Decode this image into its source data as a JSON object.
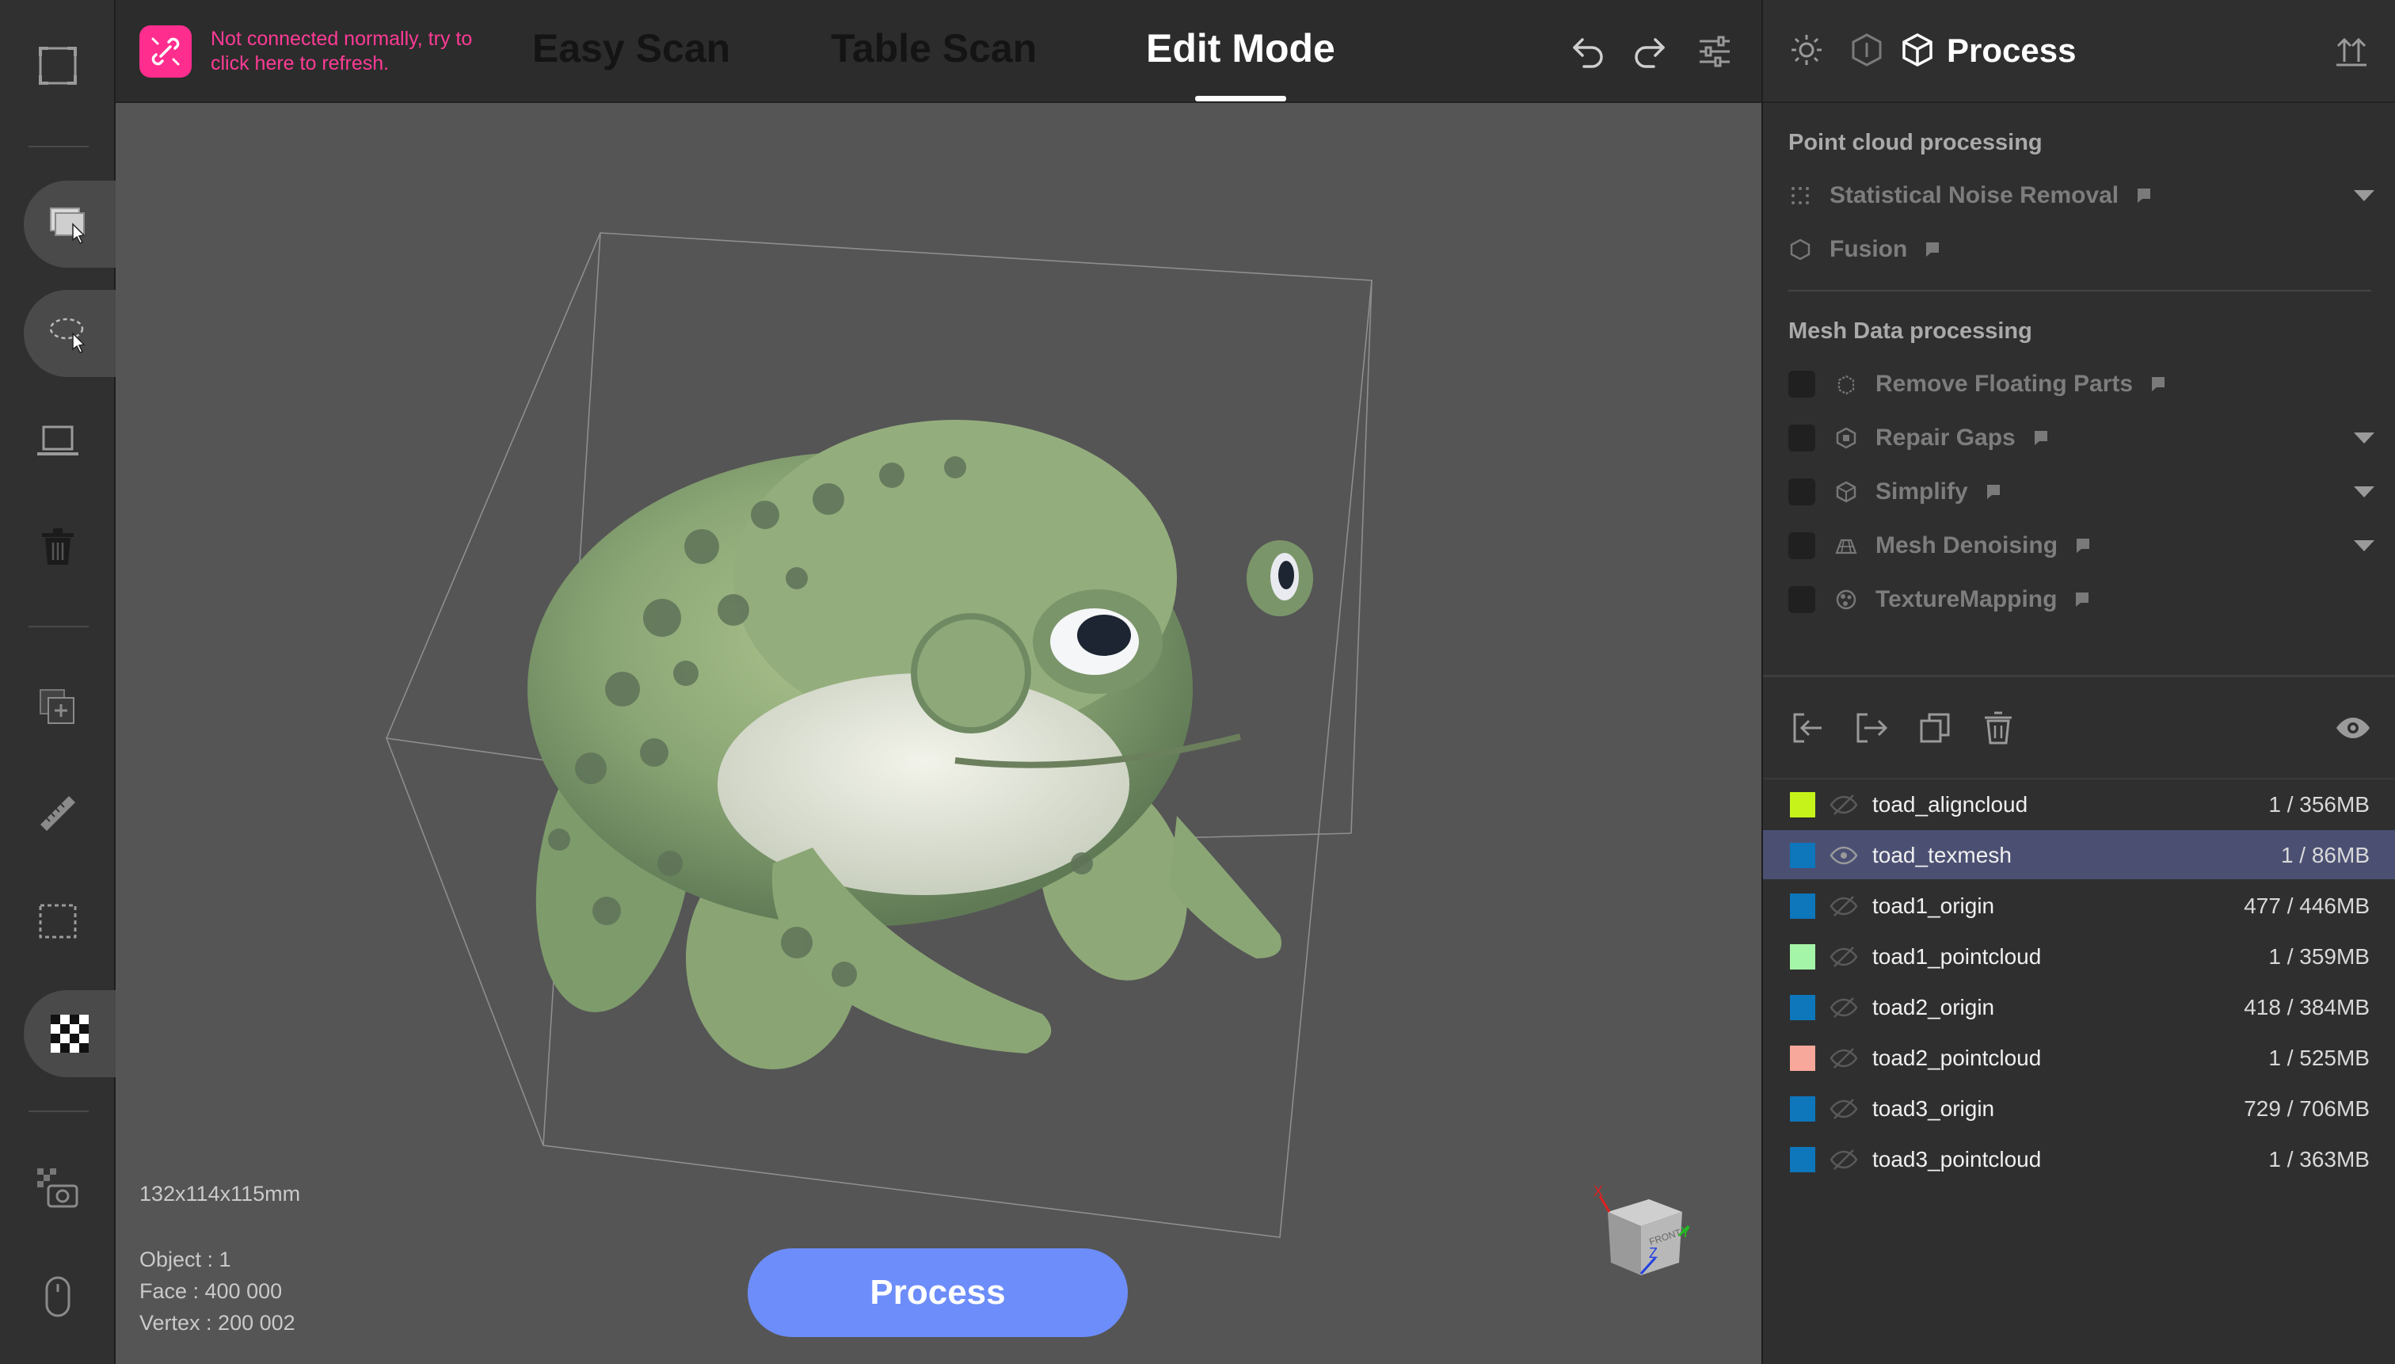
{
  "connection": {
    "message": "Not connected normally, try to click here to refresh.",
    "icon": "broken-link-icon",
    "color": "#ff2d8d"
  },
  "tabs": [
    {
      "label": "Easy Scan",
      "active": false
    },
    {
      "label": "Table Scan",
      "active": false
    },
    {
      "label": "Edit Mode",
      "active": true
    }
  ],
  "viewport": {
    "dimensions": "132x114x115mm",
    "object_line": "Object : 1",
    "face_line": "Face : 400 000",
    "vertex_line": "Vertex : 200 002",
    "process_button": "Process",
    "process_button_color": "#6d8dfa"
  },
  "panel": {
    "title": "Process",
    "point_cloud": {
      "title": "Point cloud processing",
      "items": [
        {
          "label": "Statistical Noise Removal",
          "icon": "dots-icon",
          "has_dropdown": true
        },
        {
          "label": "Fusion",
          "icon": "hexagon-icon",
          "has_dropdown": false
        }
      ]
    },
    "mesh": {
      "title": "Mesh Data processing",
      "items": [
        {
          "label": "Remove Floating Parts",
          "icon": "cube-outline-icon",
          "has_dropdown": false
        },
        {
          "label": "Repair Gaps",
          "icon": "cube-patch-icon",
          "has_dropdown": true
        },
        {
          "label": "Simplify",
          "icon": "mesh-sphere-icon",
          "has_dropdown": true
        },
        {
          "label": "Mesh Denoising",
          "icon": "mesh-surface-icon",
          "has_dropdown": true
        },
        {
          "label": "TextureMapping",
          "icon": "texture-icon",
          "has_dropdown": false
        }
      ]
    },
    "objects": [
      {
        "name": "toad_aligncloud",
        "size": "1 / 356MB",
        "color": "#c6f41a",
        "visible": false,
        "selected": false
      },
      {
        "name": "toad_texmesh",
        "size": "1 / 86MB",
        "color": "#0e76ba",
        "visible": true,
        "selected": true
      },
      {
        "name": "toad1_origin",
        "size": "477 / 446MB",
        "color": "#0e76ba",
        "visible": false,
        "selected": false
      },
      {
        "name": "toad1_pointcloud",
        "size": "1 / 359MB",
        "color": "#a5f5a8",
        "visible": false,
        "selected": false
      },
      {
        "name": "toad2_origin",
        "size": "418 / 384MB",
        "color": "#0e76ba",
        "visible": false,
        "selected": false
      },
      {
        "name": "toad2_pointcloud",
        "size": "1 / 525MB",
        "color": "#f7a89a",
        "visible": false,
        "selected": false
      },
      {
        "name": "toad3_origin",
        "size": "729 / 706MB",
        "color": "#0e76ba",
        "visible": false,
        "selected": false
      },
      {
        "name": "toad3_pointcloud",
        "size": "1 / 363MB",
        "color": "#0e76ba",
        "visible": false,
        "selected": false
      }
    ]
  }
}
